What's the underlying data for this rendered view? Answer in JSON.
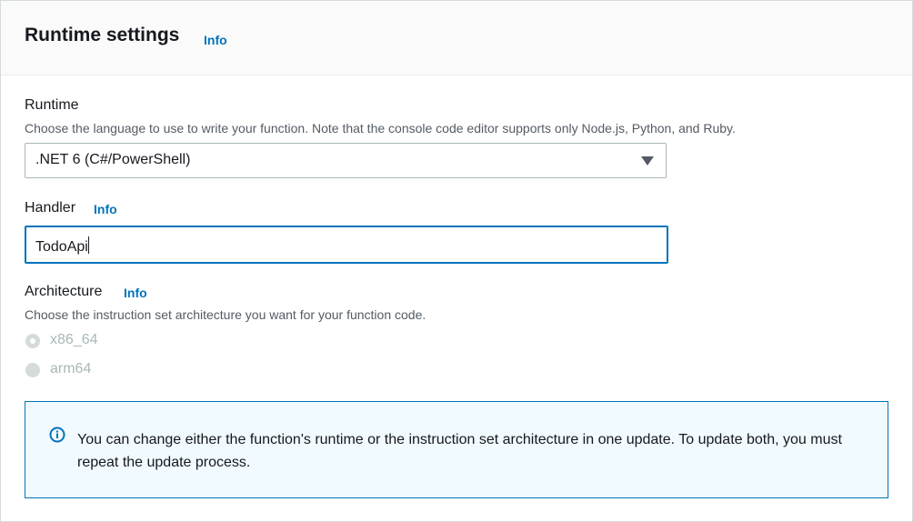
{
  "header": {
    "title": "Runtime settings",
    "info_label": "Info"
  },
  "runtime": {
    "label": "Runtime",
    "description": "Choose the language to use to write your function. Note that the console code editor supports only Node.js, Python, and Ruby.",
    "selected_value": ".NET 6 (C#/PowerShell)"
  },
  "handler": {
    "label": "Handler",
    "info_label": "Info",
    "value": "TodoApi"
  },
  "architecture": {
    "label": "Architecture",
    "info_label": "Info",
    "description": "Choose the instruction set architecture you want for your function code.",
    "options": [
      {
        "label": "x86_64",
        "selected": true,
        "disabled": true
      },
      {
        "label": "arm64",
        "selected": false,
        "disabled": true
      }
    ]
  },
  "alert": {
    "icon": "info-circle-icon",
    "text": "You can change either the function's runtime or the instruction set architecture in one update. To update both, you must repeat the update process."
  },
  "colors": {
    "link": "#0073bb",
    "input_focus_border": "#0073bb",
    "alert_background": "#f1faff",
    "disabled_text": "#aab7b8"
  }
}
